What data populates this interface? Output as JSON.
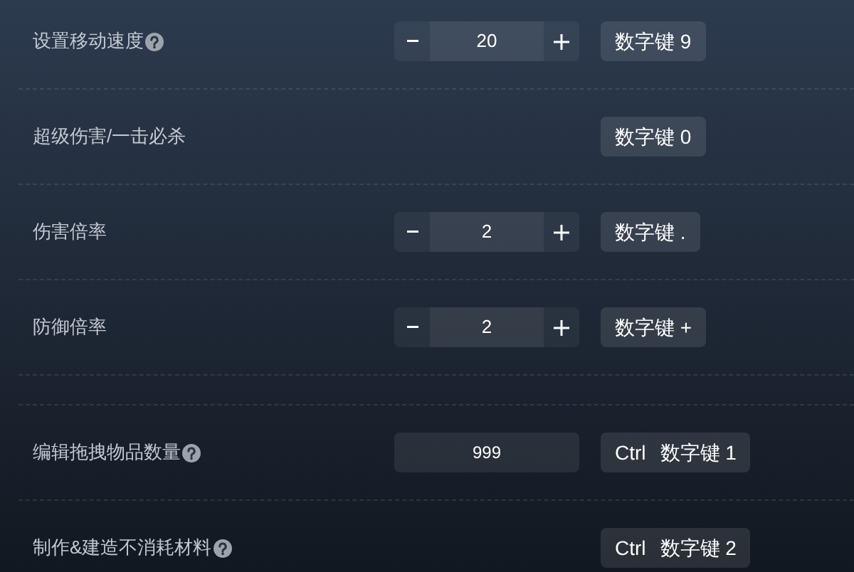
{
  "sections": [
    {
      "rows": [
        {
          "kind": "stepper",
          "label": "设置移动速度",
          "help": true,
          "value": "20",
          "hotkey": [
            "数字键 9"
          ]
        },
        {
          "kind": "toggle",
          "label": "超级伤害/一击必杀",
          "help": false,
          "hotkey": [
            "数字键 0"
          ]
        },
        {
          "kind": "stepper",
          "label": "伤害倍率",
          "help": false,
          "value": "2",
          "hotkey": [
            "数字键 ."
          ]
        },
        {
          "kind": "stepper",
          "label": "防御倍率",
          "help": false,
          "value": "2",
          "hotkey": [
            "数字键 +"
          ]
        }
      ]
    },
    {
      "rows": [
        {
          "kind": "input",
          "label": "编辑拖拽物品数量",
          "help": true,
          "value": "999",
          "hotkey": [
            "Ctrl",
            "数字键 1"
          ]
        },
        {
          "kind": "toggle",
          "label": "制作&建造不消耗材料",
          "help": true,
          "hotkey": [
            "Ctrl",
            "数字键 2"
          ]
        }
      ]
    }
  ]
}
